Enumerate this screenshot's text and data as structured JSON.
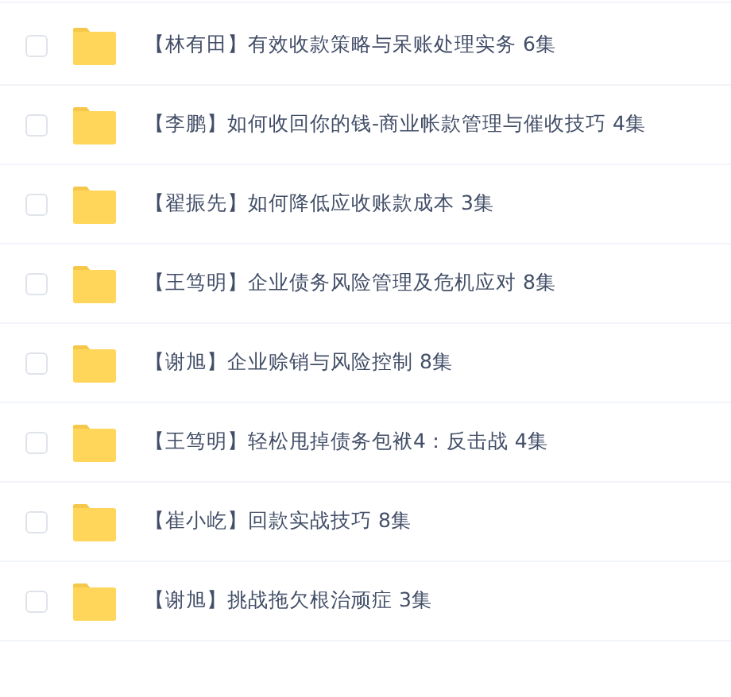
{
  "files": [
    {
      "name": "【林有田】有效收款策略与呆账处理实务 6集",
      "checked": false
    },
    {
      "name": "【李鹏】如何收回你的钱-商业帐款管理与催收技巧 4集",
      "checked": false
    },
    {
      "name": "【翟振先】如何降低应收账款成本 3集",
      "checked": false
    },
    {
      "name": "【王笃明】企业债务风险管理及危机应对 8集",
      "checked": false
    },
    {
      "name": "【谢旭】企业赊销与风险控制 8集",
      "checked": false
    },
    {
      "name": "【王笃明】轻松甩掉债务包袱4：反击战 4集",
      "checked": false
    },
    {
      "name": "【崔小屹】回款实战技巧 8集",
      "checked": false
    },
    {
      "name": "【谢旭】挑战拖欠根治顽症 3集",
      "checked": false
    }
  ]
}
